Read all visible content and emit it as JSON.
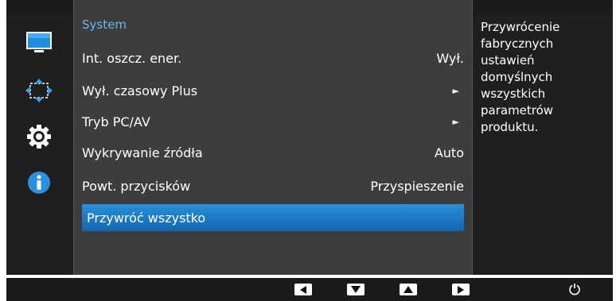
{
  "menu": {
    "title": "System",
    "items": [
      {
        "label": "Int. oszcz. ener.",
        "value": "Wył."
      },
      {
        "label": "Wył. czasowy Plus",
        "value": "►"
      },
      {
        "label": "Tryb PC/AV",
        "value": "►"
      },
      {
        "label": "Wykrywanie źródła",
        "value": "Auto"
      },
      {
        "label": "Powt. przycisków",
        "value": "Przyspieszenie"
      },
      {
        "label": "Przywróć wszystko",
        "value": ""
      }
    ],
    "selected_index": 5
  },
  "help_text": "Przywrócenie fabrycznych ustawień domyślnych wszystkich parametrów produktu.",
  "sidebar_icons": [
    "monitor-icon",
    "resize-arrows-icon",
    "gear-icon",
    "info-icon"
  ],
  "bottom_icons": [
    "left-arrow-icon",
    "down-arrow-icon",
    "up-arrow-icon",
    "right-arrow-icon",
    "power-icon"
  ],
  "colors": {
    "accent": "#6eb6ee",
    "selection": "#1a78c8",
    "panel": "#3d3d3d",
    "background": "#1b1b1b"
  }
}
